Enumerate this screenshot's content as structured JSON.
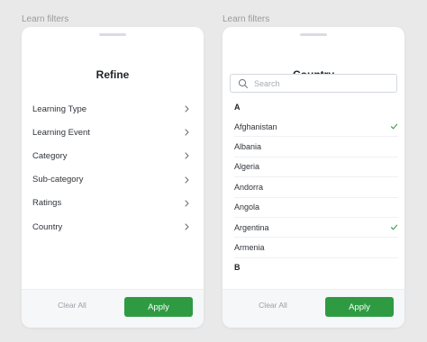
{
  "left_panel": {
    "caption": "Learn filters",
    "title": "Refine",
    "items": [
      {
        "label": "Learning Type",
        "icon": "chevron-right-icon"
      },
      {
        "label": "Learning Event",
        "icon": "chevron-right-icon"
      },
      {
        "label": "Category",
        "icon": "chevron-right-icon"
      },
      {
        "label": "Sub-category",
        "icon": "chevron-right-icon"
      },
      {
        "label": "Ratings",
        "icon": "chevron-right-icon"
      },
      {
        "label": "Country",
        "icon": "chevron-right-icon"
      }
    ],
    "footer": {
      "clear_label": "Clear All",
      "apply_label": "Apply"
    }
  },
  "right_panel": {
    "caption": "Learn filters",
    "title": "Country",
    "search": {
      "placeholder": "Search",
      "value": ""
    },
    "sections": [
      {
        "letter": "A",
        "countries": [
          {
            "name": "Afghanistan",
            "selected": true
          },
          {
            "name": "Albania",
            "selected": false
          },
          {
            "name": "Algeria",
            "selected": false
          },
          {
            "name": "Andorra",
            "selected": false
          },
          {
            "name": "Angola",
            "selected": false
          },
          {
            "name": "Argentina",
            "selected": true
          },
          {
            "name": "Armenia",
            "selected": false
          }
        ]
      },
      {
        "letter": "B",
        "countries": []
      }
    ],
    "footer": {
      "clear_label": "Clear All",
      "apply_label": "Apply"
    }
  },
  "colors": {
    "accent": "#2e9b43",
    "background": "#e9e9e9",
    "panel": "#ffffff",
    "check": "#2e9b43"
  }
}
